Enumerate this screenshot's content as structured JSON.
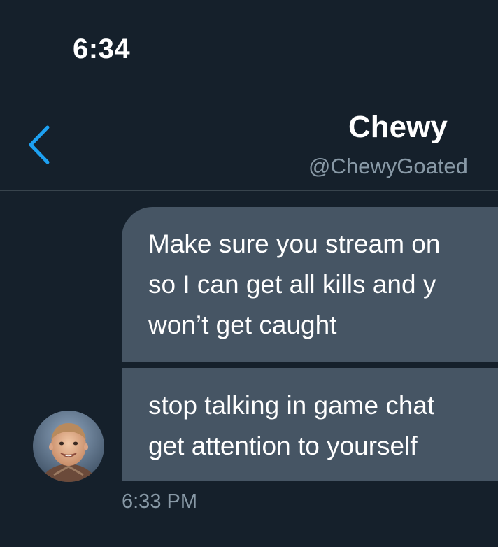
{
  "status_bar": {
    "time": "6:34"
  },
  "header": {
    "back_icon": "chevron-left-icon",
    "name": "Chewy",
    "handle": "@ChewyGoated"
  },
  "messages": [
    {
      "lines": [
        "Make sure you stream on",
        "so I can get all kills and y",
        "won’t get caught"
      ]
    },
    {
      "lines": [
        "stop talking in game chat",
        "get attention to yourself"
      ]
    }
  ],
  "conversation": {
    "avatar_icon": "user-avatar",
    "timestamp": "6:33 PM"
  },
  "colors": {
    "background": "#15202b",
    "bubble": "#465564",
    "accent": "#1da1f2",
    "secondary_text": "#8899a6",
    "divider": "#38444d"
  }
}
